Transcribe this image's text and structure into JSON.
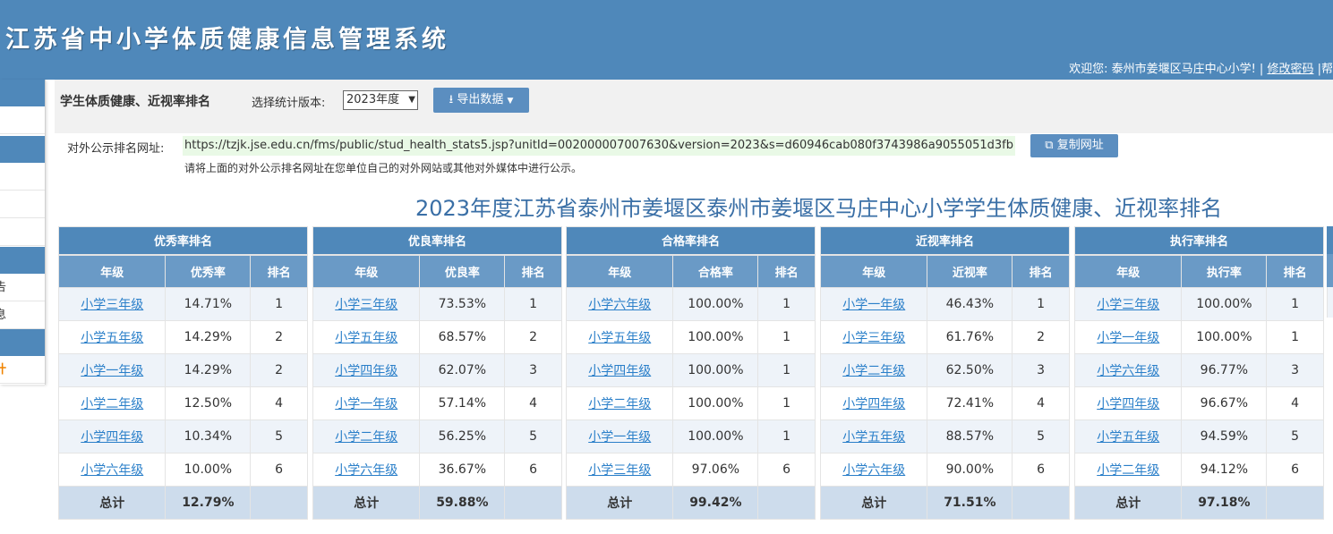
{
  "app": {
    "title": "江苏省中小学体质健康信息管理系统",
    "welcome": "欢迎您: 泰州市姜堰区马庄中心小学! |",
    "change_password": "修改密码",
    "help_fragment": "|帮"
  },
  "sidebar": {
    "items": [
      "告",
      "息",
      "计"
    ]
  },
  "toolbar": {
    "page_name": "学生体质健康、近视率排名",
    "version_label": "选择统计版本:",
    "version_value": "2023年度",
    "export_label": "导出数据"
  },
  "public_url": {
    "label": "对外公示排名网址:",
    "url": "https://tzjk.jse.edu.cn/fms/public/stud_health_stats5.jsp?unitId=002000007007630&version=2023&s=d60946cab080f3743986a9055051d3fb",
    "copy_label": "复制网址",
    "note": "请将上面的对外公示排名网址在您单位自己的对外网站或其他对外媒体中进行公示。"
  },
  "report_title": "2023年度江苏省泰州市姜堰区泰州市姜堰区马庄中心小学学生体质健康、近视率排名",
  "rank_tables": [
    {
      "title": "优秀率排名",
      "columns": [
        "年级",
        "优秀率",
        "排名"
      ],
      "rows": [
        {
          "grade": "小学三年级",
          "rate": "14.71%",
          "rank": "1"
        },
        {
          "grade": "小学五年级",
          "rate": "14.29%",
          "rank": "2"
        },
        {
          "grade": "小学一年级",
          "rate": "14.29%",
          "rank": "2"
        },
        {
          "grade": "小学二年级",
          "rate": "12.50%",
          "rank": "4"
        },
        {
          "grade": "小学四年级",
          "rate": "10.34%",
          "rank": "5"
        },
        {
          "grade": "小学六年级",
          "rate": "10.00%",
          "rank": "6"
        }
      ],
      "total_label": "总计",
      "total_rate": "12.79%"
    },
    {
      "title": "优良率排名",
      "columns": [
        "年级",
        "优良率",
        "排名"
      ],
      "rows": [
        {
          "grade": "小学三年级",
          "rate": "73.53%",
          "rank": "1"
        },
        {
          "grade": "小学五年级",
          "rate": "68.57%",
          "rank": "2"
        },
        {
          "grade": "小学四年级",
          "rate": "62.07%",
          "rank": "3"
        },
        {
          "grade": "小学一年级",
          "rate": "57.14%",
          "rank": "4"
        },
        {
          "grade": "小学二年级",
          "rate": "56.25%",
          "rank": "5"
        },
        {
          "grade": "小学六年级",
          "rate": "36.67%",
          "rank": "6"
        }
      ],
      "total_label": "总计",
      "total_rate": "59.88%"
    },
    {
      "title": "合格率排名",
      "columns": [
        "年级",
        "合格率",
        "排名"
      ],
      "rows": [
        {
          "grade": "小学六年级",
          "rate": "100.00%",
          "rank": "1"
        },
        {
          "grade": "小学五年级",
          "rate": "100.00%",
          "rank": "1"
        },
        {
          "grade": "小学四年级",
          "rate": "100.00%",
          "rank": "1"
        },
        {
          "grade": "小学二年级",
          "rate": "100.00%",
          "rank": "1"
        },
        {
          "grade": "小学一年级",
          "rate": "100.00%",
          "rank": "1"
        },
        {
          "grade": "小学三年级",
          "rate": "97.06%",
          "rank": "6"
        }
      ],
      "total_label": "总计",
      "total_rate": "99.42%"
    },
    {
      "title": "近视率排名",
      "columns": [
        "年级",
        "近视率",
        "排名"
      ],
      "rows": [
        {
          "grade": "小学一年级",
          "rate": "46.43%",
          "rank": "1"
        },
        {
          "grade": "小学三年级",
          "rate": "61.76%",
          "rank": "2"
        },
        {
          "grade": "小学二年级",
          "rate": "62.50%",
          "rank": "3"
        },
        {
          "grade": "小学四年级",
          "rate": "72.41%",
          "rank": "4"
        },
        {
          "grade": "小学五年级",
          "rate": "88.57%",
          "rank": "5"
        },
        {
          "grade": "小学六年级",
          "rate": "90.00%",
          "rank": "6"
        }
      ],
      "total_label": "总计",
      "total_rate": "71.51%"
    },
    {
      "title": "执行率排名",
      "columns": [
        "年级",
        "执行率",
        "排名"
      ],
      "rows": [
        {
          "grade": "小学三年级",
          "rate": "100.00%",
          "rank": "1"
        },
        {
          "grade": "小学一年级",
          "rate": "100.00%",
          "rank": "1"
        },
        {
          "grade": "小学六年级",
          "rate": "96.77%",
          "rank": "3"
        },
        {
          "grade": "小学四年级",
          "rate": "96.67%",
          "rank": "4"
        },
        {
          "grade": "小学五年级",
          "rate": "94.59%",
          "rank": "5"
        },
        {
          "grade": "小学二年级",
          "rate": "94.12%",
          "rank": "6"
        }
      ],
      "total_label": "总计",
      "total_rate": "97.18%"
    }
  ],
  "colors": {
    "header_blue": "#4f88ba",
    "button_blue": "#5b8ec0",
    "title_blue": "#3a6fa6",
    "link_blue": "#2a7fc9",
    "active_orange": "#f08300"
  }
}
